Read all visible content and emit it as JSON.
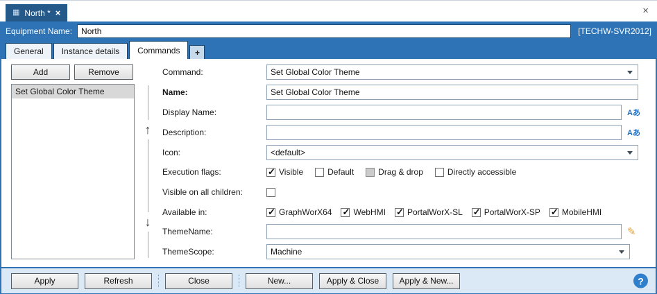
{
  "window": {
    "close_icon": "×"
  },
  "document_tab": {
    "title": "North *",
    "close_icon": "×",
    "icon": "▦"
  },
  "equipment_bar": {
    "label": "Equipment Name:",
    "value": "North",
    "server": "[TECHW-SVR2012]"
  },
  "tabs": {
    "active": "Commands",
    "items": [
      {
        "label": "General"
      },
      {
        "label": "Instance details"
      },
      {
        "label": "Commands"
      },
      {
        "label": "+"
      }
    ]
  },
  "commands_panel": {
    "add_button": "Add",
    "remove_button": "Remove",
    "list": [
      "Set Global Color Theme"
    ],
    "move_up_icon": "↑",
    "move_down_icon": "↓"
  },
  "form": {
    "command": {
      "label": "Command:",
      "value": "Set Global Color Theme"
    },
    "name": {
      "label": "Name:",
      "value": "Set Global Color Theme"
    },
    "display_name": {
      "label": "Display Name:",
      "value": "",
      "locale_icon": "Aあ"
    },
    "description": {
      "label": "Description:",
      "value": "",
      "locale_icon": "Aあ"
    },
    "icon": {
      "label": "Icon:",
      "value": "<default>"
    },
    "execution_flags": {
      "label": "Execution flags:",
      "options": [
        {
          "label": "Visible",
          "checked": true
        },
        {
          "label": "Default",
          "checked": false
        },
        {
          "label": "Drag & drop",
          "checked": false,
          "indeterminate": true
        },
        {
          "label": "Directly accessible",
          "checked": false
        }
      ]
    },
    "visible_on_all_children": {
      "label": "Visible on all children:",
      "checked": false
    },
    "available_in": {
      "label": "Available in:",
      "options": [
        {
          "label": "GraphWorX64",
          "checked": true
        },
        {
          "label": "WebHMI",
          "checked": true
        },
        {
          "label": "PortalWorX-SL",
          "checked": true
        },
        {
          "label": "PortalWorX-SP",
          "checked": true
        },
        {
          "label": "MobileHMI",
          "checked": true
        }
      ]
    },
    "theme_name": {
      "label": "ThemeName:",
      "value": "",
      "rename_icon": "✎"
    },
    "theme_scope": {
      "label": "ThemeScope:",
      "value": "Machine"
    }
  },
  "footer": {
    "buttons": [
      "Apply",
      "Refresh",
      "Close",
      "New...",
      "Apply & Close",
      "Apply & New..."
    ],
    "help_icon": "?"
  },
  "colors": {
    "accent_blue": "#2d73b5",
    "doc_tab_blue": "#24598a",
    "footer_bg": "#dbe8f5",
    "selected_item_bg": "#d8d8d8",
    "help_blue": "#2f7fcc",
    "locale_icon_blue": "#1f6fc0",
    "rename_icon_orange": "#e8a23c"
  }
}
